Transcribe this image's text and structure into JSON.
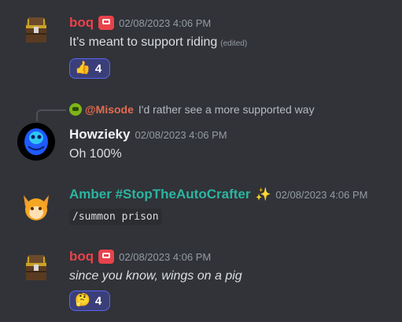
{
  "messages": [
    {
      "username": "boq",
      "timestamp": "02/08/2023 4:06 PM",
      "text": "It’s meant to support riding",
      "edited": "(edited)",
      "reaction": {
        "emoji": "👍",
        "count": "4"
      }
    },
    {
      "reply": {
        "user": "@Misode",
        "text": "I'd rather see a more supported way"
      },
      "username": "Howzieky",
      "timestamp": "02/08/2023 4:06 PM",
      "text": "Oh 100%"
    },
    {
      "username": "Amber #StopTheAutoCrafter",
      "sparkle": "✨",
      "timestamp": "02/08/2023 4:06 PM",
      "code": "/summon prison"
    },
    {
      "username": "boq",
      "timestamp": "02/08/2023 4:06 PM",
      "text": "since you know, wings on a pig",
      "reaction": {
        "emoji": "🤔",
        "count": "4"
      }
    }
  ],
  "colors": {
    "background": "#313338",
    "boq": "#e8434b",
    "howzieky": "#f2f3f5",
    "amber": "#2bb5a0",
    "misode": "#e46b4f",
    "reaction_bg": "#3b3f79",
    "reaction_border": "#5865f2"
  },
  "icons": {
    "boq_avatar": "treasure-chest",
    "howzieky_avatar": "blue-creature",
    "amber_avatar": "orange-fox",
    "badge": "red-badge-icon"
  }
}
